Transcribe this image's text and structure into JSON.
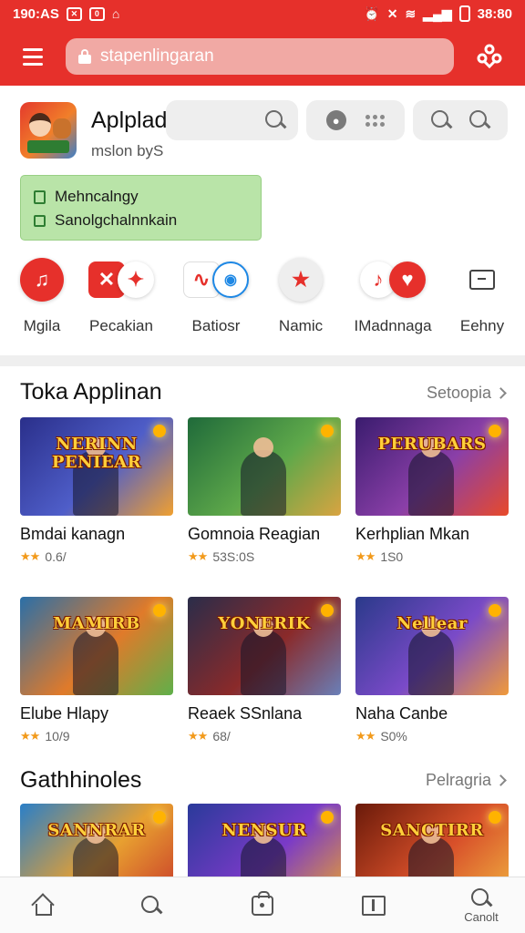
{
  "status_bar": {
    "left_text": "190:AS",
    "right_time": "38:80"
  },
  "app_bar": {
    "search_text": "stapenlingaran"
  },
  "app_header": {
    "title": "Aplpladaai",
    "subtitle": "mslon byS",
    "promo": {
      "line1": "Mehncalngy",
      "line2": "Sanolgchalnnkain"
    }
  },
  "shortcuts": [
    {
      "label": "Mgila"
    },
    {
      "label": "Pecakian"
    },
    {
      "label": "Batiosr"
    },
    {
      "label": "Namic"
    },
    {
      "label": "IMadnnaga"
    },
    {
      "label": "Eehny"
    }
  ],
  "sections": [
    {
      "title": "Toka Applinan",
      "see_all": "Setoopia",
      "apps": [
        {
          "name": "Bmdai kanagn",
          "rating": "0.6/",
          "banner": "NERINN PENIEAR",
          "colors": [
            "#2a2f8a",
            "#4f5ec9",
            "#f0a030"
          ]
        },
        {
          "name": "Gomnoia Reagian",
          "rating": "53S:0S",
          "banner": "",
          "colors": [
            "#1f6a3a",
            "#5ea84a",
            "#d9a441"
          ]
        },
        {
          "name": "Kerhplian Mkan",
          "rating": "1S0",
          "banner": "PERUBARS",
          "colors": [
            "#3a1c6e",
            "#8a3fa8",
            "#e84a2a"
          ]
        },
        {
          "name": "Elube Hlapy",
          "rating": "10/9",
          "banner": "MAMIRB",
          "colors": [
            "#2a6fa8",
            "#e07a2a",
            "#5fb04a"
          ]
        },
        {
          "name": "Reaek SSnlana",
          "rating": "68/",
          "banner": "YONERIK",
          "colors": [
            "#2a2d4a",
            "#8a2a2a",
            "#6a7fb8"
          ]
        },
        {
          "name": "Naha Canbe",
          "rating": "S0%",
          "banner": "Nellear",
          "colors": [
            "#2a3a8a",
            "#7a4ac8",
            "#f09a3a"
          ]
        }
      ]
    },
    {
      "title": "Gathhinoles",
      "see_all": "Pelragria",
      "apps": [
        {
          "banner": "SANNRAR",
          "colors": [
            "#2a7fc8",
            "#e8a030",
            "#c83a2a"
          ]
        },
        {
          "banner": "NENSUR",
          "colors": [
            "#2a3a9a",
            "#7a3ac8",
            "#e8a030"
          ]
        },
        {
          "banner": "SANCTIRR",
          "colors": [
            "#6a1a0a",
            "#d8502a",
            "#f0b040"
          ]
        }
      ]
    }
  ],
  "bottom_nav": [
    {
      "icon": "home-icon",
      "label": ""
    },
    {
      "icon": "search-icon",
      "label": ""
    },
    {
      "icon": "bag-icon",
      "label": ""
    },
    {
      "icon": "book-icon",
      "label": ""
    },
    {
      "icon": "search-icon",
      "label": "Canolt"
    }
  ],
  "colors": {
    "primary": "#e6302b",
    "promo_bg": "#b9e4a8",
    "star": "#f29a1b"
  }
}
